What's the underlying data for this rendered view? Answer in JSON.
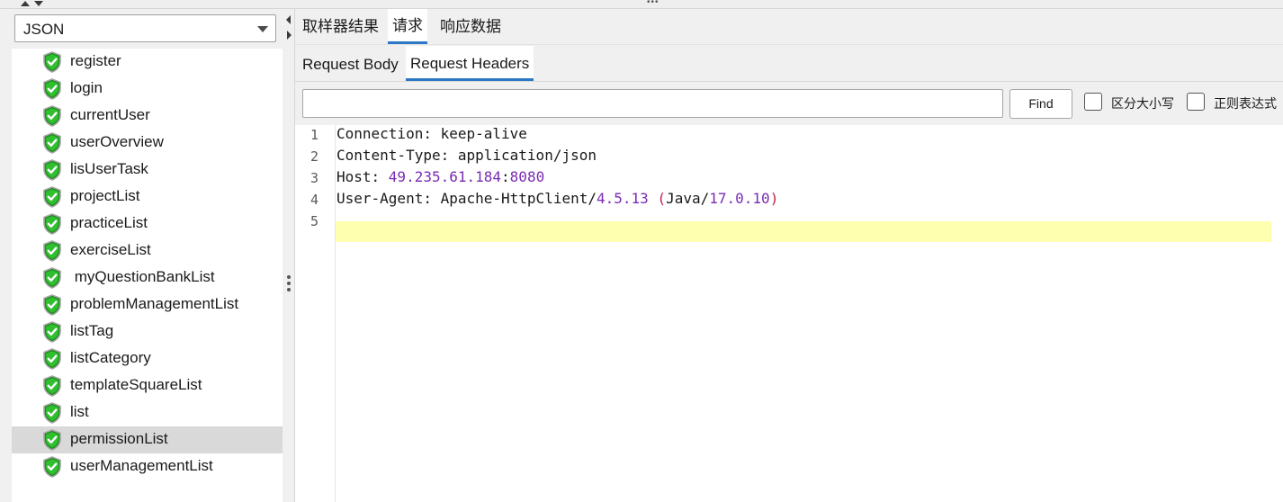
{
  "selector": {
    "value": "JSON"
  },
  "tree": {
    "items": [
      {
        "label": "register"
      },
      {
        "label": "login"
      },
      {
        "label": "currentUser"
      },
      {
        "label": "userOverview"
      },
      {
        "label": "lisUserTask"
      },
      {
        "label": "projectList"
      },
      {
        "label": "practiceList"
      },
      {
        "label": "exerciseList"
      },
      {
        "label": " myQuestionBankList"
      },
      {
        "label": "problemManagementList"
      },
      {
        "label": "listTag"
      },
      {
        "label": "listCategory"
      },
      {
        "label": "templateSquareList"
      },
      {
        "label": "list"
      },
      {
        "label": "permissionList",
        "selected": true
      },
      {
        "label": "userManagementList"
      }
    ],
    "item_icon": "green-shield-check-icon"
  },
  "tabs": [
    {
      "label": "取样器结果"
    },
    {
      "label": "请求",
      "active": true
    },
    {
      "label": "响应数据"
    }
  ],
  "subtabs": [
    {
      "label": "Request Body"
    },
    {
      "label": "Request Headers",
      "active": true
    }
  ],
  "search": {
    "value": "",
    "placeholder": "",
    "find_label": "Find"
  },
  "options": {
    "case_sensitive": "区分大小写",
    "regex": "正则表达式"
  },
  "editor": {
    "line_numbers": [
      "1",
      "2",
      "3",
      "4",
      "5"
    ],
    "lines": [
      {
        "key": "Connection",
        "sep": ": ",
        "value": "keep-alive"
      },
      {
        "key": "Content-Type",
        "sep": ": ",
        "value_a": "application",
        "slash": "/",
        "value_b": "json"
      },
      {
        "key": "Host",
        "sep": ": ",
        "ip": "49.235.61.184",
        "colon": ":",
        "port": "8080"
      },
      {
        "key": "User-Agent",
        "sep": ": ",
        "agent": "Apache-HttpClient",
        "slash1": "/",
        "ver": "4.5.13",
        "space": " ",
        "lparen": "(",
        "java": "Java",
        "slash2": "/",
        "jver": "17.0.10",
        "rparen": ")"
      },
      {
        "empty": ""
      }
    ],
    "highlight_line": "5"
  },
  "colors": {
    "accent": "#2d78c4",
    "highlight": "#ffffb0",
    "number": "#7a2bb3",
    "paren": "#c0204a"
  }
}
